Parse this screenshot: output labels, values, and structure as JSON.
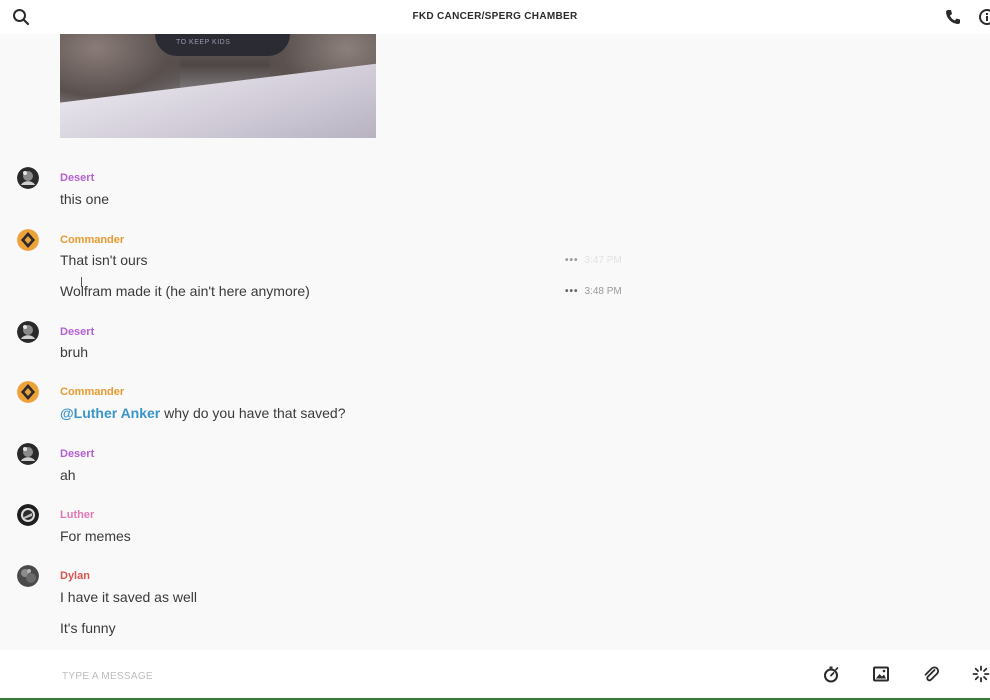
{
  "header": {
    "title": "FKD CANCER/SPERG CHAMBER"
  },
  "attachment": {
    "shirt_text": "TO KEEP KIDS"
  },
  "messages": [
    {
      "sender": "Desert",
      "color": "#b55fd3",
      "lines": [
        {
          "text": "this one"
        }
      ]
    },
    {
      "sender": "Commander",
      "color": "#e89a2c",
      "lines": [
        {
          "text": "That isn't ours",
          "time": "3:47 PM"
        },
        {
          "text": "Wolfram made it (he ain't here anymore)",
          "time": "3:48 PM"
        }
      ]
    },
    {
      "sender": "Desert",
      "color": "#b55fd3",
      "lines": [
        {
          "text": "bruh"
        }
      ]
    },
    {
      "sender": "Commander",
      "color": "#e89a2c",
      "lines": [
        {
          "mention": "@Luther Anker",
          "text": " why do you have that saved?"
        }
      ]
    },
    {
      "sender": "Desert",
      "color": "#b55fd3",
      "lines": [
        {
          "text": "ah"
        }
      ]
    },
    {
      "sender": "Luther",
      "color": "#e477b3",
      "lines": [
        {
          "text": "For memes"
        }
      ]
    },
    {
      "sender": "Dylan",
      "color": "#d9544f",
      "lines": [
        {
          "text": "I have it saved as well"
        },
        {
          "text": "It's funny"
        }
      ]
    }
  ],
  "composer": {
    "placeholder": "TYPE A MESSAGE"
  },
  "icons": {
    "search": "search-icon",
    "call": "phone-icon",
    "info": "info-icon",
    "timer": "stopwatch-icon",
    "image": "image-icon",
    "attach": "paperclip-icon",
    "sparkle": "sparkle-icon"
  },
  "colors": {
    "mention": "#3a96c9",
    "text": "#3a3a3a",
    "accent_bottom": "#3c7a3c"
  }
}
